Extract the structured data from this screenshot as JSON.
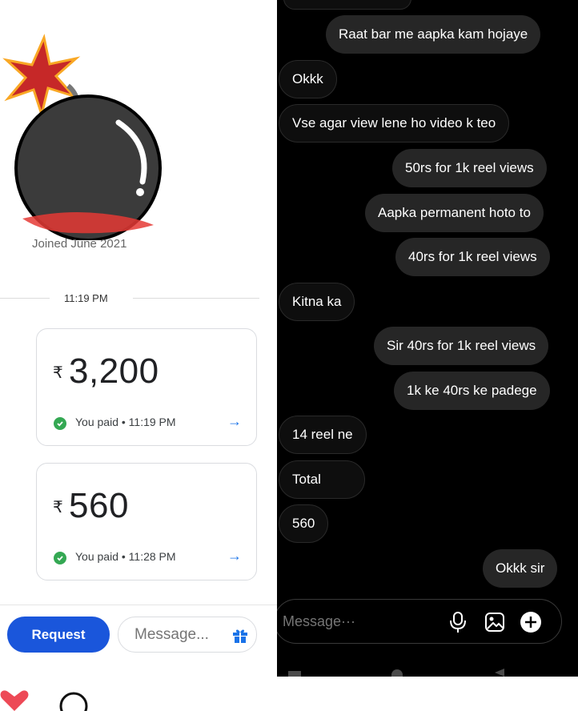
{
  "profile": {
    "joined_text": "Joined June 2021"
  },
  "payments": {
    "time_divider": "11:19 PM",
    "currency_symbol": "₹",
    "cards": [
      {
        "amount": "3,200",
        "status": "You paid • 11:19 PM"
      },
      {
        "amount": "560",
        "status": "You paid • 11:28 PM"
      }
    ],
    "actions": {
      "request_label": "Request",
      "message_placeholder": "Message..."
    }
  },
  "chat": {
    "messages": [
      {
        "text": "Raat bar me aapka kam hojaye",
        "from": "sent"
      },
      {
        "text": "Okkk",
        "from": "received"
      },
      {
        "text": "Vse agar view lene ho video k teo",
        "from": "received"
      },
      {
        "text": "50rs for 1k reel  views",
        "from": "sent"
      },
      {
        "text": "Aapka permanent hoto to",
        "from": "sent"
      },
      {
        "text": "40rs for 1k reel views",
        "from": "sent"
      },
      {
        "text": "Kitna ka",
        "from": "received"
      },
      {
        "text": "Sir 40rs for 1k reel views",
        "from": "sent"
      },
      {
        "text": "1k ke 40rs ke padege",
        "from": "sent"
      },
      {
        "text": "14 reel ne",
        "from": "received"
      },
      {
        "text": "Total",
        "from": "received"
      },
      {
        "text": "560",
        "from": "received"
      },
      {
        "text": "Okkk sir",
        "from": "sent"
      }
    ],
    "composer_placeholder": "Message···"
  },
  "colors": {
    "accent_blue": "#1a56db",
    "chat_bg": "#000000",
    "bubble_sent": "#262626",
    "heart_red": "#ed4956"
  },
  "icons": [
    "bomb-sticker",
    "check-icon",
    "arrow-right-icon",
    "gift-icon",
    "microphone-icon",
    "image-icon",
    "add-icon",
    "heart-icon",
    "comment-icon"
  ]
}
